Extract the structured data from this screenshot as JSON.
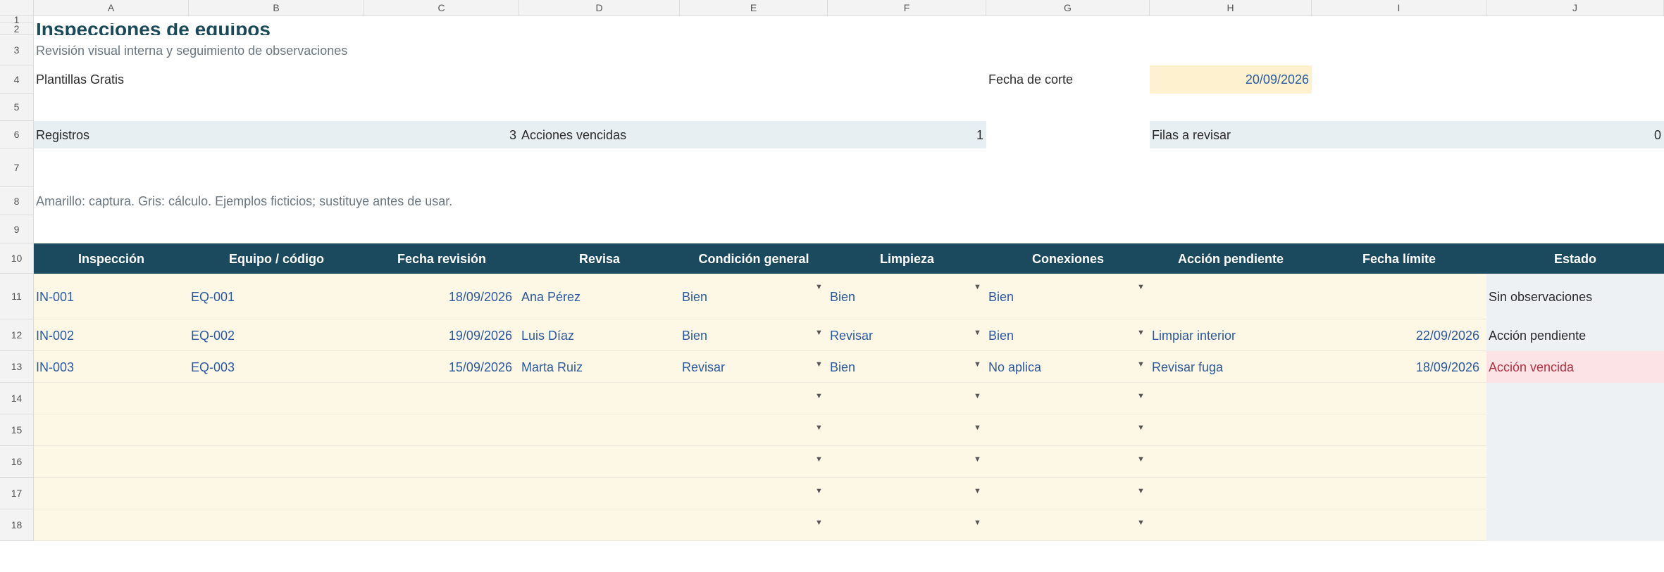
{
  "columns": [
    "A",
    "B",
    "C",
    "D",
    "E",
    "F",
    "G",
    "H",
    "I",
    "J"
  ],
  "rows": [
    "1",
    "2",
    "3",
    "4",
    "5",
    "6",
    "7",
    "8",
    "9",
    "10",
    "11",
    "12",
    "13",
    "14",
    "15",
    "16",
    "17",
    "18"
  ],
  "title": "Inspecciones de equipos",
  "subtitle": "Revisión visual interna y seguimiento de observaciones",
  "brand": "Plantillas Gratis",
  "cutoff": {
    "label": "Fecha de corte",
    "value": "20/09/2026"
  },
  "kpis": [
    {
      "label": "Registros",
      "value": "3"
    },
    {
      "label": "Acciones vencidas",
      "value": "1"
    },
    {
      "label": "Filas a revisar",
      "value": "0"
    }
  ],
  "note": "Amarillo: captura. Gris: cálculo. Ejemplos ficticios; sustituye antes de usar.",
  "headers": [
    "Inspección",
    "Equipo / código",
    "Fecha revisión",
    "Revisa",
    "Condición general",
    "Limpieza",
    "Conexiones",
    "Acción pendiente",
    "Fecha límite",
    "Estado"
  ],
  "records": [
    {
      "id": "IN-001",
      "equipo": "EQ-001",
      "fecha": "18/09/2026",
      "revisa": "Ana Pérez",
      "condicion": "Bien",
      "limpieza": "Bien",
      "conexiones": "Bien",
      "accion": "",
      "limite": "",
      "estado": "Sin observaciones",
      "status": "ok"
    },
    {
      "id": "IN-002",
      "equipo": "EQ-002",
      "fecha": "19/09/2026",
      "revisa": "Luis Díaz",
      "condicion": "Bien",
      "limpieza": "Revisar",
      "conexiones": "Bien",
      "accion": "Limpiar interior",
      "limite": "22/09/2026",
      "estado": "Acción pendiente",
      "status": "pending"
    },
    {
      "id": "IN-003",
      "equipo": "EQ-003",
      "fecha": "15/09/2026",
      "revisa": "Marta Ruiz",
      "condicion": "Revisar",
      "limpieza": "Bien",
      "conexiones": "No aplica",
      "accion": "Revisar fuga",
      "limite": "18/09/2026",
      "estado": "Acción vencida",
      "status": "overdue"
    }
  ],
  "empty_rows": 5,
  "colors": {
    "header_bg": "#1b4a5e",
    "input_bg": "#fdf7e6",
    "calc_bg": "#eef1f4",
    "overdue_bg": "#fbe3e6",
    "title": "#1a4a5a"
  }
}
